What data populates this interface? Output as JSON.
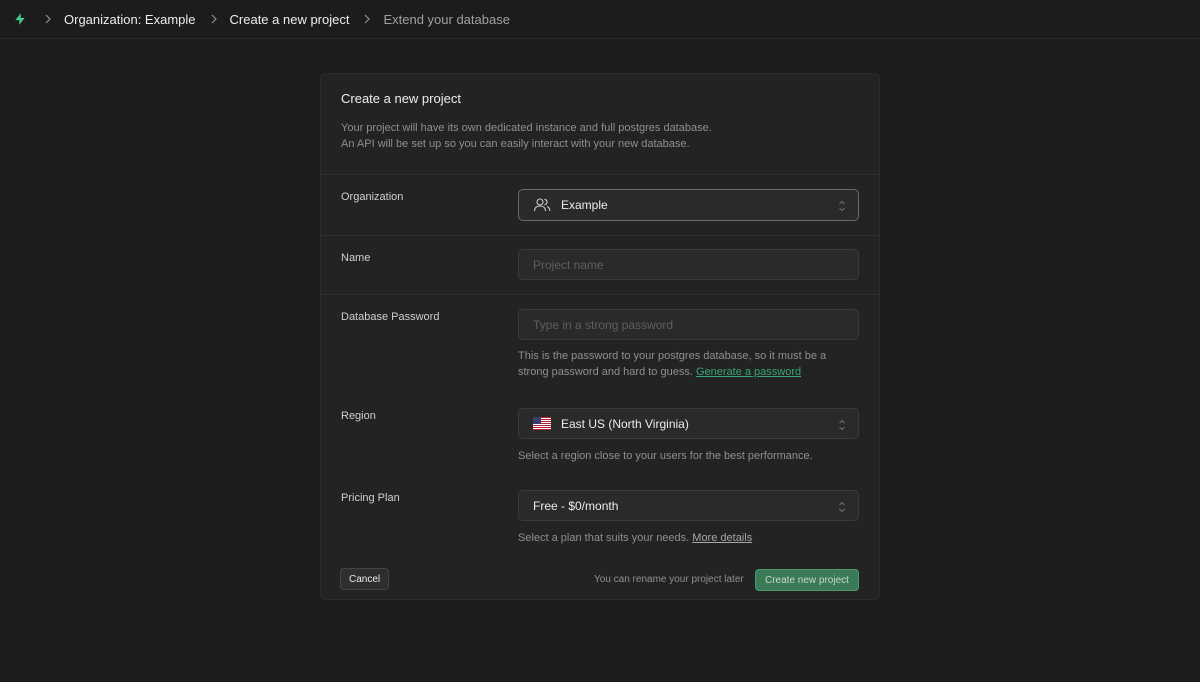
{
  "breadcrumb": {
    "items": [
      {
        "label": "Organization: Example"
      },
      {
        "label": "Create a new project"
      },
      {
        "label": "Extend your database"
      }
    ]
  },
  "colors": {
    "brand": "#3ecf8e",
    "background": "#1c1c1c",
    "card": "#232323",
    "primary_button": "#3b7a57"
  },
  "form": {
    "title": "Create a new project",
    "description_line1": "Your project will have its own dedicated instance and full postgres database.",
    "description_line2": "An API will be set up so you can easily interact with your new database.",
    "organization": {
      "label": "Organization",
      "value": "Example",
      "icon": "users-icon"
    },
    "name": {
      "label": "Name",
      "placeholder": "Project name",
      "value": ""
    },
    "password": {
      "label": "Database Password",
      "placeholder": "Type in a strong password",
      "value": "",
      "help_line1": "This is the password to your postgres database, so it must be a",
      "help_line2": "strong password and hard to guess.",
      "generate_link": "Generate a password"
    },
    "region": {
      "label": "Region",
      "value": "East US (North Virginia)",
      "flag": "us-flag-icon",
      "help": "Select a region close to your users for the best performance."
    },
    "plan": {
      "label": "Pricing Plan",
      "value": "Free - $0/month",
      "help": "Select a plan that suits your needs.",
      "details_link": "More details"
    }
  },
  "footer": {
    "cancel_label": "Cancel",
    "note": "You can rename your project later",
    "create_label": "Create new project"
  }
}
